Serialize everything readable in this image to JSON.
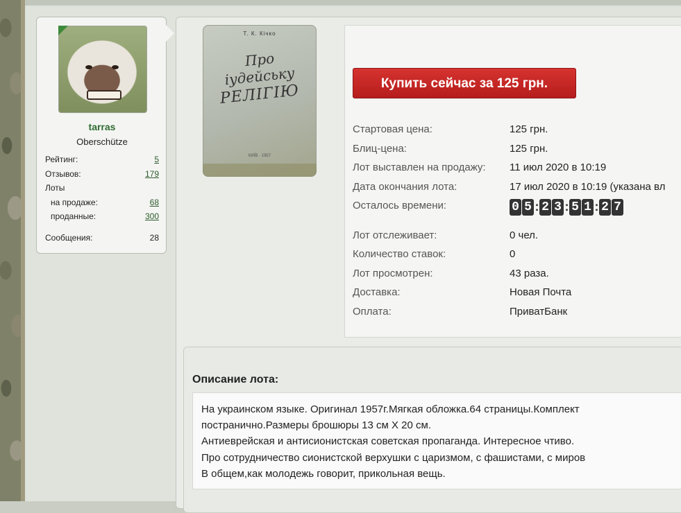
{
  "user": {
    "name": "tarras",
    "title": "Oberschütze",
    "stats": [
      {
        "label": "Рейтинг:",
        "value": "5",
        "link": true,
        "sub": false
      },
      {
        "label": "Отзывов:",
        "value": "179",
        "link": true,
        "sub": false
      },
      {
        "label": "Лоты",
        "value": "",
        "link": false,
        "sub": false
      },
      {
        "label": "на продаже:",
        "value": "68",
        "link": true,
        "sub": true
      },
      {
        "label": "проданные:",
        "value": "300",
        "link": true,
        "sub": true
      },
      {
        "label": "Сообщения:",
        "value": "28",
        "link": false,
        "sub": false
      }
    ]
  },
  "book_cover": {
    "author": "Т. К. Кічко",
    "title_line1": "Про",
    "title_line2": "іудейську",
    "title_line3": "РЕЛІГІЮ",
    "publisher": "КИЇВ · 1957"
  },
  "lot": {
    "buy_button": "Купить сейчас за 125 грн.",
    "rows": [
      {
        "label": "Стартовая цена:",
        "value": "125 грн."
      },
      {
        "label": "Блиц-цена:",
        "value": "125 грн."
      },
      {
        "label": "Лот выставлен на продажу:",
        "value": "11 июл 2020 в 10:19"
      },
      {
        "label": "Дата окончания лота:",
        "value": "17 июл 2020 в 10:19 (указана вл"
      },
      {
        "label": "Осталось времени:",
        "value": ""
      },
      {
        "label": "Лот отслеживает:",
        "value": "0 чел."
      },
      {
        "label": "Количество ставок:",
        "value": "0"
      },
      {
        "label": "Лот просмотрен:",
        "value": "43 раза."
      },
      {
        "label": "Доставка:",
        "value": "Новая Почта"
      },
      {
        "label": "Оплата:",
        "value": "ПриватБанк"
      }
    ],
    "timer_digits": [
      "0",
      "5",
      ":",
      "2",
      "3",
      ":",
      "5",
      "1",
      ":",
      "2",
      "7"
    ]
  },
  "description": {
    "title": "Описание лота:",
    "lines": [
      "На украинском языке. Оригинал 1957г.Мягкая обложка.64 страницы.Комплект",
      "постранично.Размеры брошюры 13 см Х 20 см.",
      "Антиеврейская и антисионистская советская пропаганда. Интересное чтиво.",
      "Про сотрудничество сионистской верхушки с царизмом, с фашистами, с миров",
      "В общем,как молодежь говорит, прикольная вещь."
    ]
  }
}
